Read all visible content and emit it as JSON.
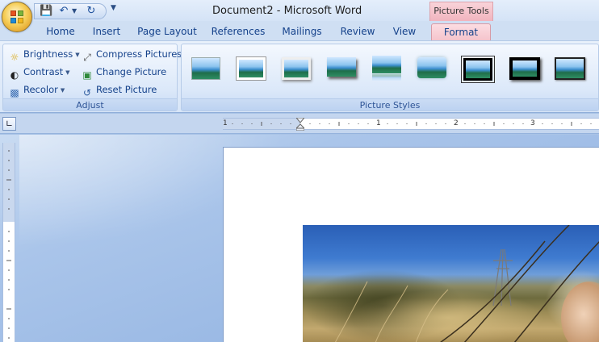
{
  "window": {
    "title": "Document2 - Microsoft Word",
    "contextual_group": "Picture Tools"
  },
  "quick_access": {
    "items": [
      "save-icon",
      "undo-icon",
      "redo-icon",
      "customize-icon"
    ]
  },
  "tabs": [
    {
      "label": "Home"
    },
    {
      "label": "Insert"
    },
    {
      "label": "Page Layout"
    },
    {
      "label": "References"
    },
    {
      "label": "Mailings"
    },
    {
      "label": "Review"
    },
    {
      "label": "View"
    },
    {
      "label": "Format",
      "active": true
    }
  ],
  "ribbon": {
    "adjust": {
      "label": "Adjust",
      "brightness": "Brightness",
      "contrast": "Contrast",
      "recolor": "Recolor",
      "compress": "Compress Pictures",
      "change": "Change Picture",
      "reset": "Reset Picture"
    },
    "picture_styles": {
      "label": "Picture Styles",
      "thumb_count": 9,
      "selected_index": 6
    }
  },
  "ruler": {
    "numbers": [
      "1",
      "1",
      "2",
      "3"
    ]
  },
  "colors": {
    "ribbon_bg": "#dbe8f9",
    "tab_text": "#15428b",
    "contextual_pink": "#f5c4cc",
    "workspace": "#a9c3e6"
  }
}
